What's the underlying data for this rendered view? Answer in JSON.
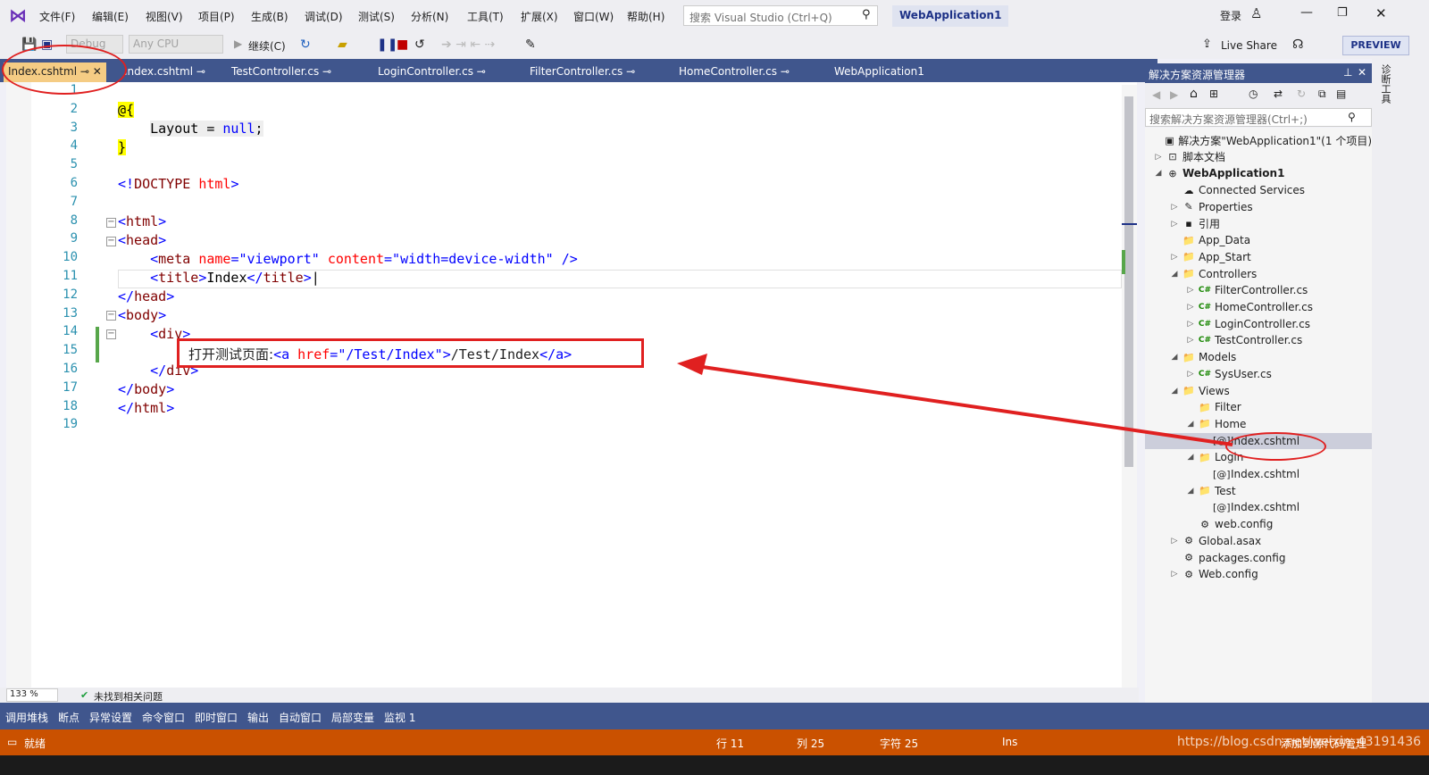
{
  "menu": {
    "items": [
      "文件(F)",
      "编辑(E)",
      "视图(V)",
      "项目(P)",
      "生成(B)",
      "调试(D)",
      "测试(S)",
      "分析(N)",
      "工具(T)",
      "扩展(X)",
      "窗口(W)",
      "帮助(H)"
    ],
    "search_placeholder": "搜索 Visual Studio (Ctrl+Q)",
    "app_title": "WebApplication1",
    "login": "登录"
  },
  "toolbar": {
    "config": "Debug",
    "platform": "Any CPU",
    "continue_label": "继续(C)",
    "live_share": "Live Share",
    "preview": "PREVIEW"
  },
  "tabs": [
    {
      "label": "Index.cshtml",
      "active": true
    },
    {
      "label": "Index.cshtml",
      "active": false
    },
    {
      "label": "TestController.cs",
      "active": false
    },
    {
      "label": "LoginController.cs",
      "active": false
    },
    {
      "label": "FilterController.cs",
      "active": false
    },
    {
      "label": "HomeController.cs",
      "active": false
    },
    {
      "label": "WebApplication1",
      "active": false
    }
  ],
  "editor": {
    "line_numbers": [
      "1",
      "2",
      "3",
      "4",
      "5",
      "6",
      "7",
      "8",
      "9",
      "10",
      "11",
      "12",
      "13",
      "14",
      "15",
      "16",
      "17",
      "18",
      "19"
    ],
    "callout": {
      "prefix": "打开测试页面:",
      "a_open": "<a",
      "attr": "href",
      "eq": "=",
      "value": "\"/Test/Index\"",
      "close": ">",
      "text": "/Test/Index",
      "a_close": "</a>"
    },
    "zoom": "133 %",
    "issues": "未找到相关问题"
  },
  "solution_explorer": {
    "title": "解决方案资源管理器",
    "search_placeholder": "搜索解决方案资源管理器(Ctrl+;)",
    "nodes": [
      {
        "label": "解决方案\"WebApplication1\"(1 个项目)",
        "depth": 0,
        "expander": "",
        "icon": "▣"
      },
      {
        "label": "脚本文档",
        "depth": 0,
        "expander": "▷",
        "icon": "⊡"
      },
      {
        "label": "WebApplication1",
        "depth": 0,
        "expander": "◢",
        "icon": "⊕",
        "bold": true
      },
      {
        "label": "Connected Services",
        "depth": 1,
        "expander": "",
        "icon": "☁"
      },
      {
        "label": "Properties",
        "depth": 1,
        "expander": "▷",
        "icon": "✎"
      },
      {
        "label": "引用",
        "depth": 1,
        "expander": "▷",
        "icon": "▪"
      },
      {
        "label": "App_Data",
        "depth": 1,
        "expander": "",
        "icon": "📁"
      },
      {
        "label": "App_Start",
        "depth": 1,
        "expander": "▷",
        "icon": "📁"
      },
      {
        "label": "Controllers",
        "depth": 1,
        "expander": "◢",
        "icon": "📁"
      },
      {
        "label": "FilterController.cs",
        "depth": 2,
        "expander": "▷",
        "icon": "C#"
      },
      {
        "label": "HomeController.cs",
        "depth": 2,
        "expander": "▷",
        "icon": "C#"
      },
      {
        "label": "LoginController.cs",
        "depth": 2,
        "expander": "▷",
        "icon": "C#"
      },
      {
        "label": "TestController.cs",
        "depth": 2,
        "expander": "▷",
        "icon": "C#"
      },
      {
        "label": "Models",
        "depth": 1,
        "expander": "◢",
        "icon": "📁"
      },
      {
        "label": "SysUser.cs",
        "depth": 2,
        "expander": "▷",
        "icon": "C#"
      },
      {
        "label": "Views",
        "depth": 1,
        "expander": "◢",
        "icon": "📁"
      },
      {
        "label": "Filter",
        "depth": 2,
        "expander": "",
        "icon": "📁"
      },
      {
        "label": "Home",
        "depth": 2,
        "expander": "◢",
        "icon": "📁"
      },
      {
        "label": "Index.cshtml",
        "depth": 3,
        "expander": "",
        "icon": "[@]",
        "selected": true
      },
      {
        "label": "Login",
        "depth": 2,
        "expander": "◢",
        "icon": "📁"
      },
      {
        "label": "Index.cshtml",
        "depth": 3,
        "expander": "",
        "icon": "[@]"
      },
      {
        "label": "Test",
        "depth": 2,
        "expander": "◢",
        "icon": "📁"
      },
      {
        "label": "Index.cshtml",
        "depth": 3,
        "expander": "",
        "icon": "[@]"
      },
      {
        "label": "web.config",
        "depth": 2,
        "expander": "",
        "icon": "⚙"
      },
      {
        "label": "Global.asax",
        "depth": 1,
        "expander": "▷",
        "icon": "⚙"
      },
      {
        "label": "packages.config",
        "depth": 1,
        "expander": "",
        "icon": "⚙"
      },
      {
        "label": "Web.config",
        "depth": 1,
        "expander": "▷",
        "icon": "⚙"
      }
    ],
    "side_label": "诊断工具"
  },
  "bottom_tabs": [
    "调用堆栈",
    "断点",
    "异常设置",
    "命令窗口",
    "即时窗口",
    "输出",
    "自动窗口",
    "局部变量",
    "监视 1"
  ],
  "status": {
    "ready": "就绪",
    "line": "行 11",
    "col": "列 25",
    "char": "字符 25",
    "ins": "Ins",
    "source_control": "添加到源代码管理",
    "watermark": "https://blog.csdn.net/weixin_43191436"
  },
  "colors": {
    "accent": "#40568d",
    "status": "#ca5100",
    "active_tab": "#f5cc84",
    "annotation": "#e02020"
  }
}
